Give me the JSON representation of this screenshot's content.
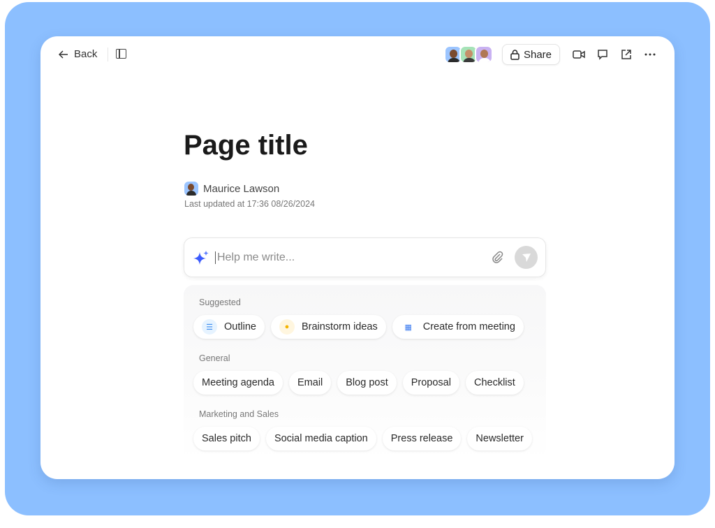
{
  "header": {
    "back_label": "Back",
    "share_label": "Share"
  },
  "page": {
    "title": "Page title",
    "author": "Maurice Lawson",
    "updated": "Last updated at 17:36 08/26/2024"
  },
  "composer": {
    "placeholder": "Help me write..."
  },
  "sections": {
    "suggested": {
      "label": "Suggested",
      "chips": [
        "Outline",
        "Brainstorm ideas",
        "Create from meeting"
      ]
    },
    "general": {
      "label": "General",
      "chips": [
        "Meeting agenda",
        "Email",
        "Blog post",
        "Proposal",
        "Checklist"
      ]
    },
    "marketing": {
      "label": "Marketing and Sales",
      "chips": [
        "Sales pitch",
        "Social media caption",
        "Press release",
        "Newsletter"
      ]
    }
  },
  "colors": {
    "frame": "#8cbfff",
    "accent": "#3b5bfd"
  }
}
